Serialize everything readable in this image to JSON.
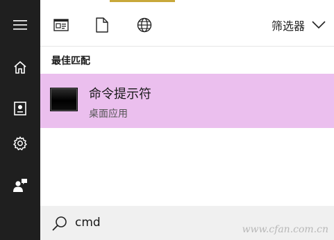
{
  "sidebar": {
    "items": [
      {
        "icon": "hamburger-menu-icon"
      },
      {
        "icon": "home-icon"
      },
      {
        "icon": "notebook-icon"
      },
      {
        "icon": "gear-icon"
      },
      {
        "icon": "feedback-icon"
      }
    ]
  },
  "toolbar": {
    "filters": [
      {
        "icon": "apps-icon"
      },
      {
        "icon": "document-icon"
      },
      {
        "icon": "globe-icon"
      }
    ],
    "filter_label": "筛选器",
    "filter_icon": "chevron-down-icon"
  },
  "results": {
    "section_title": "最佳匹配",
    "best_match": {
      "name": "命令提示符",
      "type": "桌面应用"
    }
  },
  "search": {
    "value": "cmd",
    "icon": "search-icon"
  },
  "watermark": "www.cfan.com.cn",
  "colors": {
    "sidebar_bg": "#1f1f1f",
    "highlight": "#ebbfee",
    "search_bg": "#f0f0f0"
  }
}
